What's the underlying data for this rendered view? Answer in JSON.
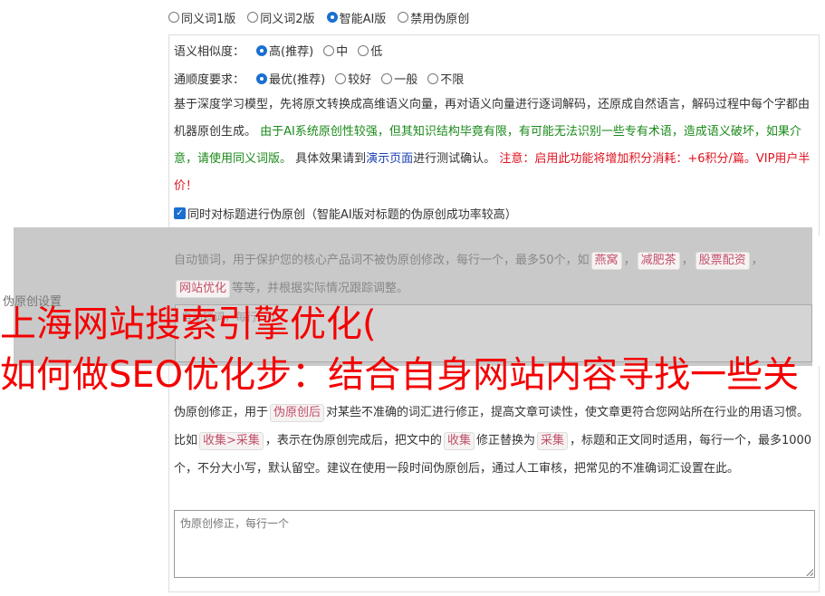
{
  "version_options": [
    {
      "label": "同义词1版",
      "checked": false
    },
    {
      "label": "同义词2版",
      "checked": false
    },
    {
      "label": "智能AI版",
      "checked": true
    },
    {
      "label": "禁用伪原创",
      "checked": false
    }
  ],
  "similarity": {
    "label": "语义相似度：",
    "options": [
      {
        "label": "高(推荐)",
        "checked": true
      },
      {
        "label": "中",
        "checked": false
      },
      {
        "label": "低",
        "checked": false
      }
    ]
  },
  "fluency": {
    "label": "通顺度要求：",
    "options": [
      {
        "label": "最优(推荐)",
        "checked": true
      },
      {
        "label": "较好",
        "checked": false
      },
      {
        "label": "一般",
        "checked": false
      },
      {
        "label": "不限",
        "checked": false
      }
    ]
  },
  "description": {
    "part1": "基于深度学习模型，先将原文转换成高维语义向量，再对语义向量进行逐词解码，还原成自然语言，解码过程中每个字都由机器原创生成。 ",
    "part2_green": "由于AI系统原创性较强，但其知识结构毕竟有限，有可能无法识别一些专有术语，造成语义破坏，如果介意，请使用同义词版。",
    "part3": " 具体效果请到",
    "link": "演示页面",
    "part4": "进行测试确认。 ",
    "part5_red": "注意：启用此功能将增加积分消耗：+6积分/篇。VIP用户半价！"
  },
  "title_checkbox": {
    "label": "同时对标题进行伪原创（智能AI版对标题的伪原创成功率较高）",
    "checked": true
  },
  "lock_words": {
    "text1": "自动锁词，用于保护您的核心产品词不被伪原创修改，每行一个，最多50个，如",
    "tags": [
      "燕窝",
      "减肥茶",
      "股票配资",
      "网站优化"
    ],
    "sep": "，",
    "text2": "等等，并根据实际情况跟踪调整。",
    "placeholder": "自动锁词，每行一个"
  },
  "side_label": "伪原创设置",
  "correction": {
    "text1": "伪原创修正，用于",
    "tag1": "伪原创后",
    "text2": "对某些不准确的词汇进行修正，提高文章可读性，使文章更符合您网站所在行业的用语习惯。比如",
    "tag2": "收集>采集",
    "text3": "，表示在伪原创完成后，把文中的",
    "tag3": "收集",
    "text4": "修正替换为",
    "tag4": "采集",
    "text5": "，标题和正文同时适用，每行一个，最多1000个，不分大小写，默认留空。建议在使用一段时间伪原创后，通过人工审核，把常见的不准确词汇设置在此。",
    "placeholder": "伪原创修正，每行一个"
  },
  "overlay_ad": {
    "line1": "上海网站搜索引擎优化(",
    "line2": "如何做SEO优化步：结合自身网站内容寻找一些关"
  }
}
